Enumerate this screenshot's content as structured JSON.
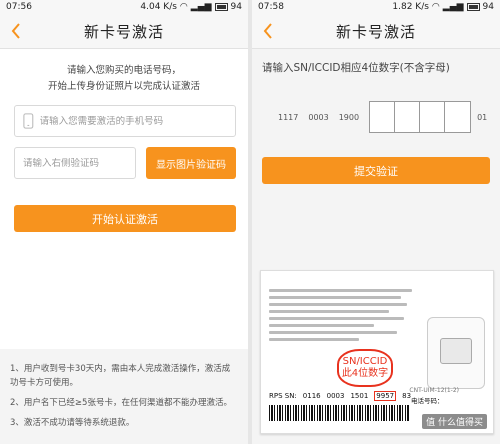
{
  "left": {
    "status": {
      "time": "07:56",
      "speed": "4.04",
      "speed_unit": "K/s",
      "battery": "94"
    },
    "title": "新卡号激活",
    "intro_line1": "请输入您购买的电话号码，",
    "intro_line2": "开始上传身份证照片以完成认证激活",
    "phone_placeholder": "请输入您需要激活的手机号码",
    "code_placeholder": "请输入右侧验证码",
    "show_code_button": "显示图片验证码",
    "start_button": "开始认证激活",
    "notes": [
      "1、用户收到号卡30天内，需由本人完成激活操作，激活成功号卡方可使用。",
      "2、用户名下已经≥5张号卡，在任何渠道都不能办理激活。",
      "3、激活不成功请等待系统退款。"
    ]
  },
  "right": {
    "status": {
      "time": "07:58",
      "speed": "1.82",
      "speed_unit": "K/s",
      "battery": "94"
    },
    "title": "新卡号激活",
    "prompt": "请输入SN/ICCID相应4位数字(不含字母)",
    "sn_prefix": [
      "1117",
      "0003",
      "1900"
    ],
    "sn_suffix": "01",
    "submit_button": "提交验证",
    "card": {
      "callout_line1": "SN/ICCID",
      "callout_line2": "此4位数字",
      "rps_label": "RPS SN:",
      "sn_groups": [
        "0116",
        "0003",
        "1501"
      ],
      "sn_highlight": "9957",
      "sn_tail": "83",
      "card_no_label": "电话号码：",
      "card_model": "CNT-UIM-12(1-2)",
      "watermark": "值 什么值得买"
    }
  },
  "colors": {
    "accent": "#f7931e",
    "callout": "#e8321e"
  }
}
